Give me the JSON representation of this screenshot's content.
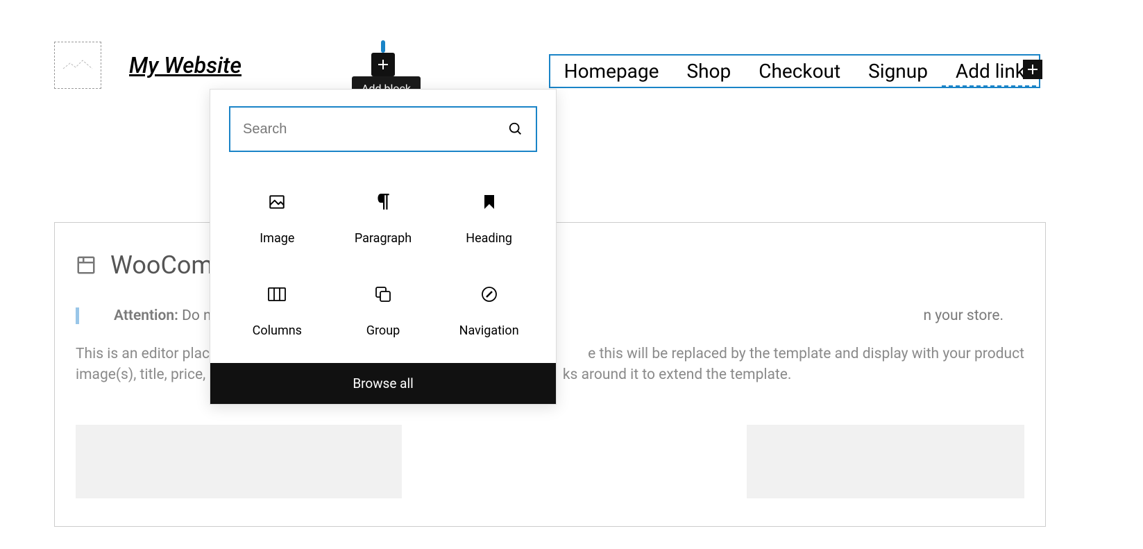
{
  "header": {
    "site_title": "My Website"
  },
  "nav": {
    "items": [
      "Homepage",
      "Shop",
      "Checkout",
      "Signup"
    ],
    "add_link_label": "Add link"
  },
  "add_block": {
    "tooltip": "Add block"
  },
  "inserter": {
    "search_placeholder": "Search",
    "blocks": [
      {
        "name": "Image"
      },
      {
        "name": "Paragraph"
      },
      {
        "name": "Heading"
      },
      {
        "name": "Columns"
      },
      {
        "name": "Group"
      },
      {
        "name": "Navigation"
      }
    ],
    "browse_all": "Browse all"
  },
  "content": {
    "title_visible": "WooCom",
    "attention_label": "Attention:",
    "attention_visible": "Do no",
    "desc_line1_left": "This is an editor placeho",
    "desc_line1_right": "e this will be replaced by the template and display with your product",
    "desc_line2_left": "image(s), title, price, etc",
    "desc_line2_right": "ks around it to extend the template.",
    "right_bar_text": "n your store."
  }
}
